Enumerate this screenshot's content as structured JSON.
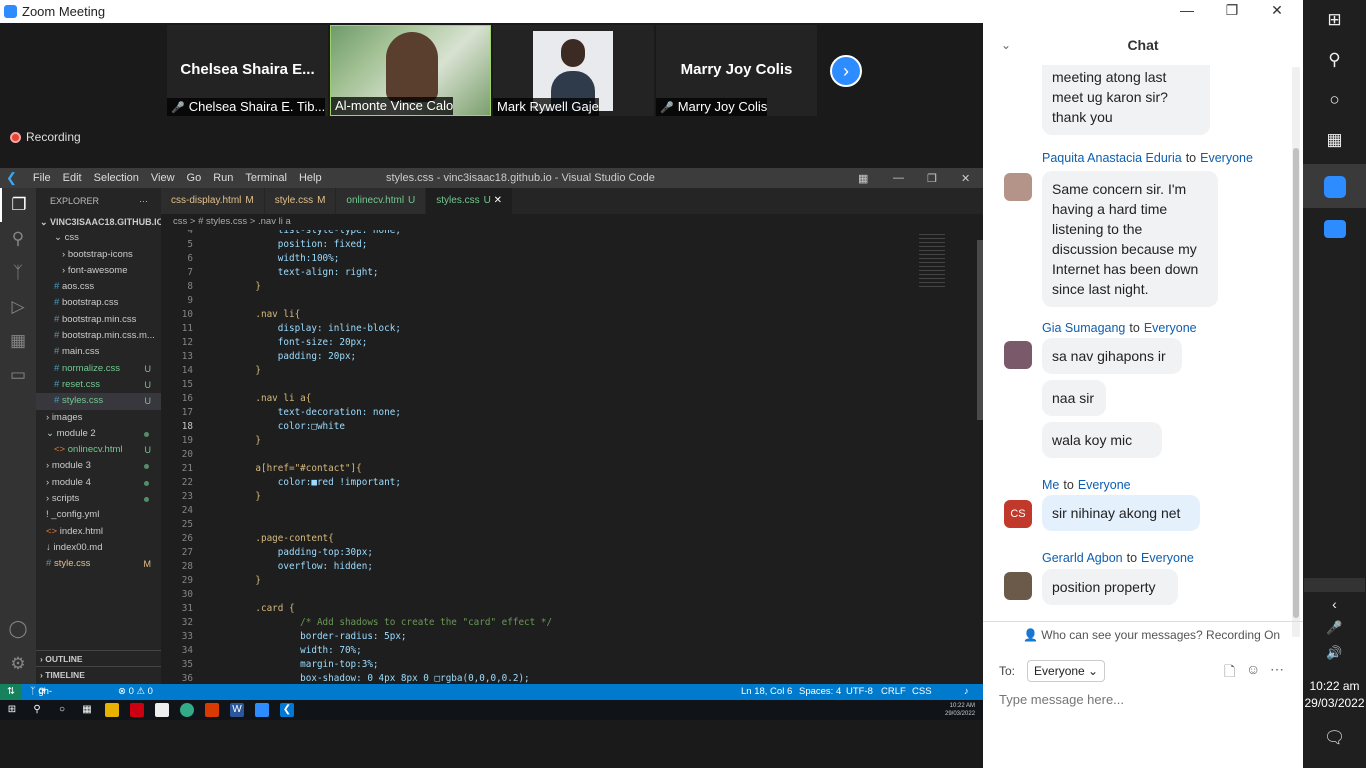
{
  "zoom": {
    "title": "Zoom Meeting",
    "recording": "Recording",
    "participants": [
      {
        "name_big": "Chelsea Shaira E...",
        "caption": "Chelsea Shaira E. Tib...",
        "muted": true
      },
      {
        "caption": "Al-monte Vince Calo",
        "muted": false
      },
      {
        "caption": "Mark Rywell Gaje",
        "muted": false
      },
      {
        "name_big": "Marry Joy Colis",
        "caption": "Marry Joy Colis",
        "muted": true
      }
    ]
  },
  "vscode": {
    "menu": [
      "File",
      "Edit",
      "Selection",
      "View",
      "Go",
      "Run",
      "Terminal",
      "Help"
    ],
    "window_title": "styles.css - vinc3isaac18.github.io - Visual Studio Code",
    "explorer_header": "EXPLORER",
    "root": "VINC3ISAAC18.GITHUB.IO",
    "files": [
      {
        "label": "css",
        "depth": 1,
        "type": "folder-open",
        "badge": ""
      },
      {
        "label": "bootstrap-icons",
        "depth": 2,
        "type": "folder",
        "badge": ""
      },
      {
        "label": "font-awesome",
        "depth": 2,
        "type": "folder",
        "badge": ""
      },
      {
        "label": "aos.css",
        "depth": 1,
        "type": "css",
        "badge": ""
      },
      {
        "label": "bootstrap.css",
        "depth": 1,
        "type": "css",
        "badge": ""
      },
      {
        "label": "bootstrap.min.css",
        "depth": 1,
        "type": "css",
        "badge": ""
      },
      {
        "label": "bootstrap.min.css.m...",
        "depth": 1,
        "type": "css",
        "badge": ""
      },
      {
        "label": "main.css",
        "depth": 1,
        "type": "css",
        "badge": ""
      },
      {
        "label": "normalize.css",
        "depth": 1,
        "type": "css",
        "badge": "U"
      },
      {
        "label": "reset.css",
        "depth": 1,
        "type": "css",
        "badge": "U"
      },
      {
        "label": "styles.css",
        "depth": 1,
        "type": "css",
        "badge": "U"
      },
      {
        "label": "images",
        "depth": 0,
        "type": "folder",
        "badge": ""
      },
      {
        "label": "module 2",
        "depth": 0,
        "type": "folder-open",
        "badge": "dot"
      },
      {
        "label": "onlinecv.html",
        "depth": 1,
        "type": "html",
        "badge": "U"
      },
      {
        "label": "module 3",
        "depth": 0,
        "type": "folder",
        "badge": "dot"
      },
      {
        "label": "module 4",
        "depth": 0,
        "type": "folder",
        "badge": "dot"
      },
      {
        "label": "scripts",
        "depth": 0,
        "type": "folder",
        "badge": "dot"
      },
      {
        "label": "_config.yml",
        "depth": 0,
        "type": "yml",
        "badge": ""
      },
      {
        "label": "index.html",
        "depth": 0,
        "type": "html",
        "badge": ""
      },
      {
        "label": "index00.md",
        "depth": 0,
        "type": "md",
        "badge": ""
      },
      {
        "label": "style.css",
        "depth": 0,
        "type": "css",
        "badge": "M"
      }
    ],
    "outline": "OUTLINE",
    "timeline": "TIMELINE",
    "tabs": [
      {
        "label": "css-display.html",
        "badge": "M",
        "active": false
      },
      {
        "label": "style.css",
        "badge": "M",
        "active": false
      },
      {
        "label": "onlinecv.html",
        "badge": "U",
        "active": false
      },
      {
        "label": "styles.css",
        "badge": "U",
        "active": true
      }
    ],
    "breadcrumb": "css  >  # styles.css  >  .nav li a",
    "code": [
      {
        "n": "4",
        "t": "        list-style-type: none;"
      },
      {
        "n": "5",
        "t": "        position: fixed;"
      },
      {
        "n": "6",
        "t": "        width:100%;"
      },
      {
        "n": "7",
        "t": "        text-align: right;"
      },
      {
        "n": "8",
        "t": "    }"
      },
      {
        "n": "9",
        "t": ""
      },
      {
        "n": "10",
        "t": "    .nav li{"
      },
      {
        "n": "11",
        "t": "        display: inline-block;"
      },
      {
        "n": "12",
        "t": "        font-size: 20px;"
      },
      {
        "n": "13",
        "t": "        padding: 20px;"
      },
      {
        "n": "14",
        "t": "    }"
      },
      {
        "n": "15",
        "t": ""
      },
      {
        "n": "16",
        "t": "    .nav li a{"
      },
      {
        "n": "17",
        "t": "        text-decoration: none;"
      },
      {
        "n": "18",
        "t": "        color:□white"
      },
      {
        "n": "19",
        "t": "    }"
      },
      {
        "n": "20",
        "t": ""
      },
      {
        "n": "21",
        "t": "    a[href=\"#contact\"]{"
      },
      {
        "n": "22",
        "t": "        color:■red !important;"
      },
      {
        "n": "23",
        "t": "    }"
      },
      {
        "n": "24",
        "t": ""
      },
      {
        "n": "25",
        "t": ""
      },
      {
        "n": "26",
        "t": "    .page-content{"
      },
      {
        "n": "27",
        "t": "        padding-top:30px;"
      },
      {
        "n": "28",
        "t": "        overflow: hidden;"
      },
      {
        "n": "29",
        "t": "    }"
      },
      {
        "n": "30",
        "t": ""
      },
      {
        "n": "31",
        "t": "    .card {"
      },
      {
        "n": "32",
        "t": "            /* Add shadows to create the \"card\" effect */"
      },
      {
        "n": "33",
        "t": "            border-radius: 5px;"
      },
      {
        "n": "34",
        "t": "            width: 70%;"
      },
      {
        "n": "35",
        "t": "            margin-top:3%;"
      },
      {
        "n": "36",
        "t": "            box-shadow: 0 4px 8px 0 □rgba(0,0,0,0.2);"
      }
    ],
    "status": {
      "branch": "gh-pages*",
      "problems": "⊗ 0 ⚠ 0",
      "position": "Ln 18, Col 6",
      "spaces": "Spaces: 4",
      "encoding": "UTF-8",
      "eol": "CRLF",
      "lang": "CSS"
    }
  },
  "taskbar_small": {
    "time": "10:22 AM",
    "date": "29/03/2022"
  },
  "chat": {
    "title": "Chat",
    "messages": [
      {
        "kind": "cont",
        "text": "meeting atong last meet ug karon sir? thank you"
      },
      {
        "kind": "sender",
        "from": "Paquita Anastacia Eduria",
        "to_word": "to",
        "to": "Everyone"
      },
      {
        "kind": "msg",
        "text": "Same concern sir. I'm having a hard time listening to the discussion because my Internet has been down since last night."
      },
      {
        "kind": "sender",
        "from": "Gia Sumagang",
        "to_word": "to",
        "to": "Everyone"
      },
      {
        "kind": "msg",
        "text": "sa nav gihapons ir"
      },
      {
        "kind": "msg",
        "text": "naa sir"
      },
      {
        "kind": "msg",
        "text": "wala koy mic"
      },
      {
        "kind": "sender",
        "from": "Me",
        "to_word": "to",
        "to": "Everyone"
      },
      {
        "kind": "msg",
        "text": "sir nihinay akong net",
        "avatar": "CS"
      },
      {
        "kind": "sender",
        "from": "Gerarld Agbon",
        "to_word": "to",
        "to": "Everyone"
      },
      {
        "kind": "msg",
        "text": "position property"
      }
    ],
    "who_can_see": "Who can see your messages? Recording On",
    "to_label": "To:",
    "to_value": "Everyone",
    "input_placeholder": "Type message here..."
  },
  "system_tray": {
    "time": "10:22 am",
    "date": "29/03/2022"
  }
}
